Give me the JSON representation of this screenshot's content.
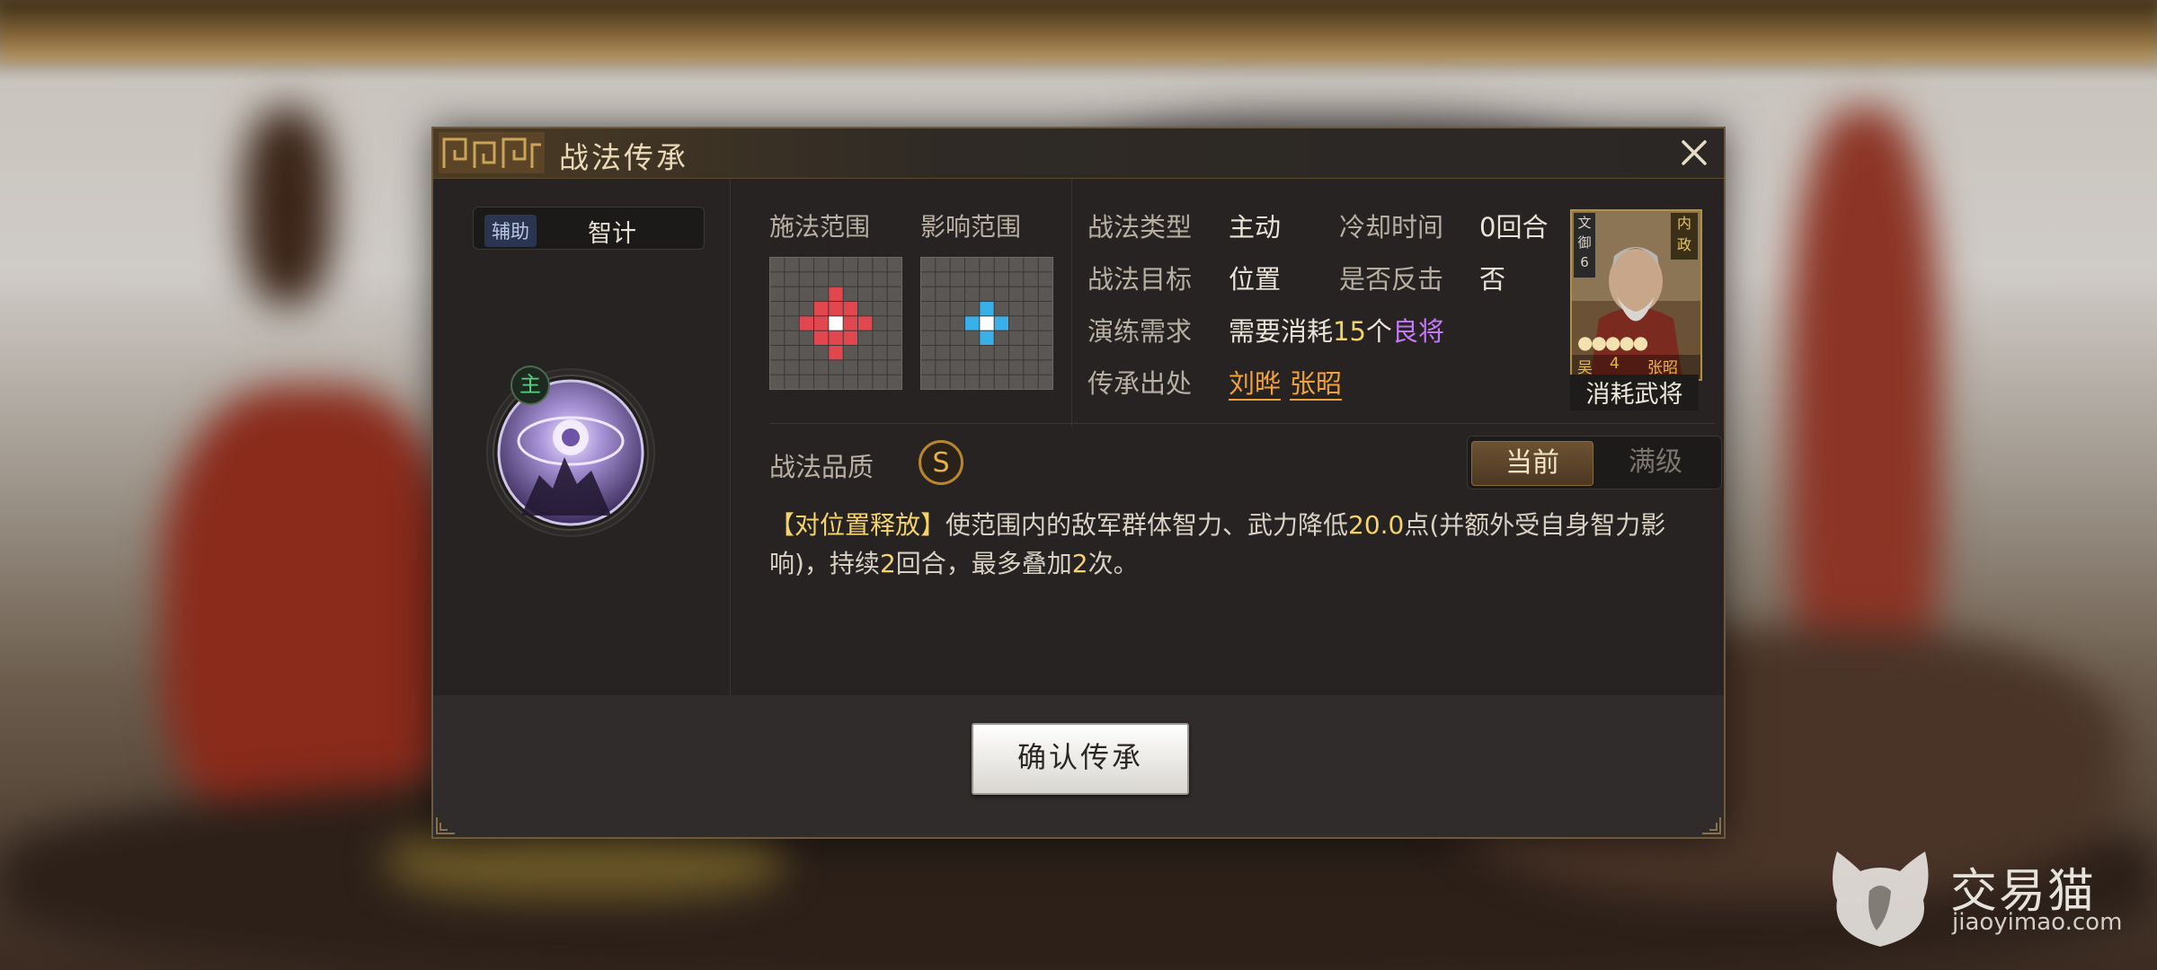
{
  "dialog": {
    "title": "战法传承",
    "left": {
      "tag_badge": "辅助",
      "tag_text": "智计",
      "main_badge": "主"
    },
    "grids": {
      "cast_range_label": "施法范围",
      "effect_range_label": "影响范围"
    },
    "info": {
      "type_label": "战法类型",
      "type_value": "主动",
      "cooldown_label": "冷却时间",
      "cooldown_value": "0回合",
      "target_label": "战法目标",
      "target_value": "位置",
      "counter_label": "是否反击",
      "counter_value": "否",
      "train_label": "演练需求",
      "train_prefix": "需要消耗",
      "train_count": "15",
      "train_unit": "个",
      "train_item": "良将",
      "source_label": "传承出处",
      "source_1": "刘晔",
      "source_2": "张昭"
    },
    "card": {
      "top_right_1": "内",
      "top_right_2": "政",
      "top_left_1": "文",
      "top_left_2": "御",
      "top_left_3": "6",
      "stars": "●●●●●",
      "faction": "吴",
      "cost": "4",
      "name": "张昭",
      "caption": "消耗武将"
    },
    "quality": {
      "label": "战法品质",
      "grade": "S",
      "toggle_current": "当前",
      "toggle_max": "满级"
    },
    "description": {
      "tag": "【对位置释放】",
      "part1": "使范围内的敌军群体智力、武力降低",
      "num1": "20.0",
      "part2": "点(并额外受自身智力影响)，持续",
      "num2": "2",
      "part3": "回合，最多叠加",
      "num3": "2",
      "part4": "次。"
    },
    "confirm_label": "确认传承"
  },
  "watermark": {
    "name": "交易猫",
    "url": "jiaoyimao.com"
  },
  "colors": {
    "accent_gold": "#b8862e",
    "cast_red": "#e0474f",
    "effect_blue": "#3ab0e8",
    "highlight_yellow": "#f0d468",
    "link_orange": "#f0a13e",
    "purple": "#c27bf4"
  }
}
